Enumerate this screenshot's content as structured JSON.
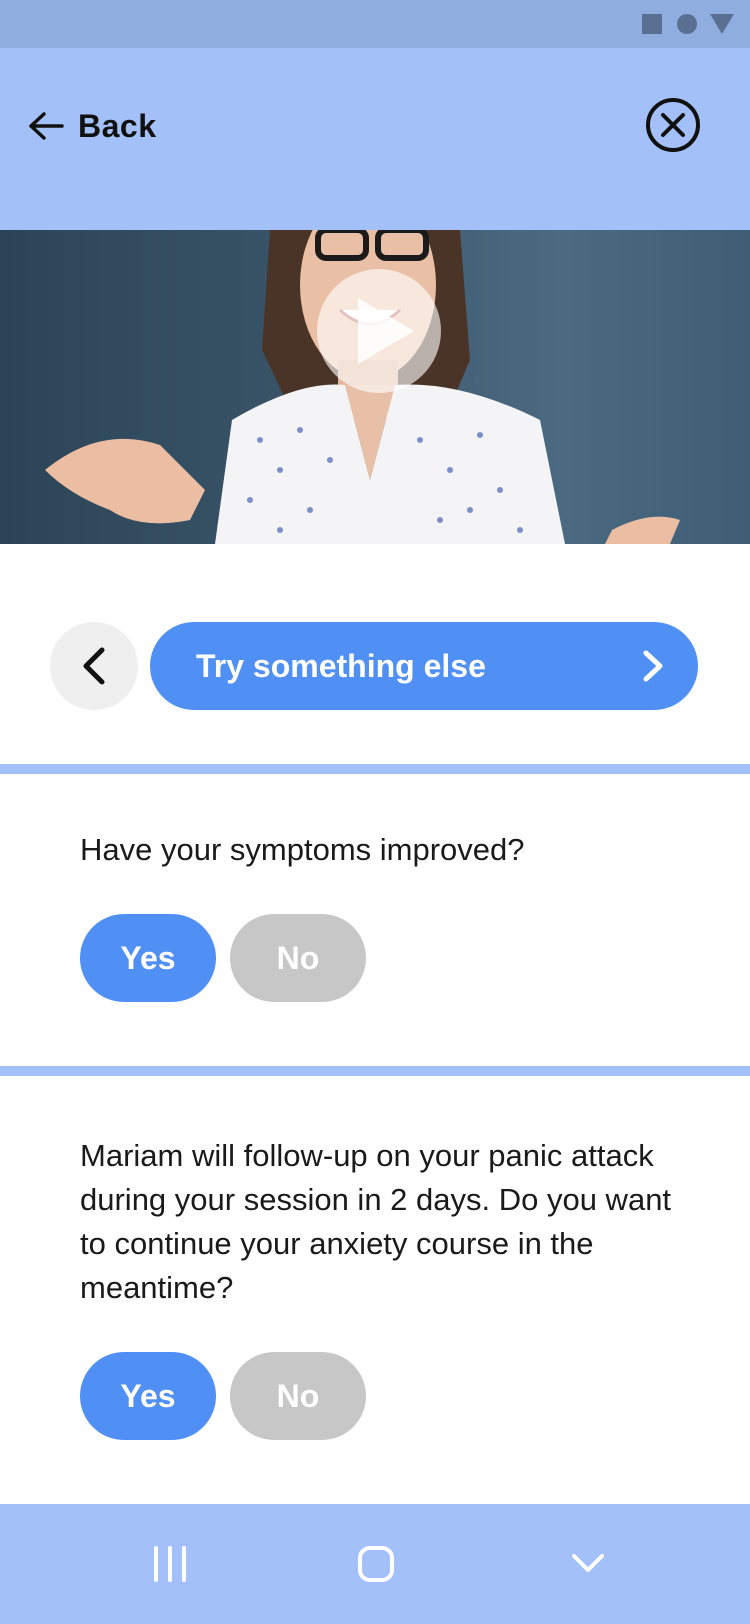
{
  "header": {
    "back_label": "Back"
  },
  "controls": {
    "try_label": "Try something else"
  },
  "question1": {
    "text": "Have your symptoms improved?",
    "yes_label": "Yes",
    "no_label": "No"
  },
  "question2": {
    "text": "Mariam will follow-up on your panic attack during your session in 2 days. Do you want to continue your anxiety course in the meantime?",
    "yes_label": "Yes",
    "no_label": "No"
  },
  "colors": {
    "accent": "#5090f5",
    "header_bg": "#a3c1f8",
    "neutral_button": "#c7c7c7"
  }
}
